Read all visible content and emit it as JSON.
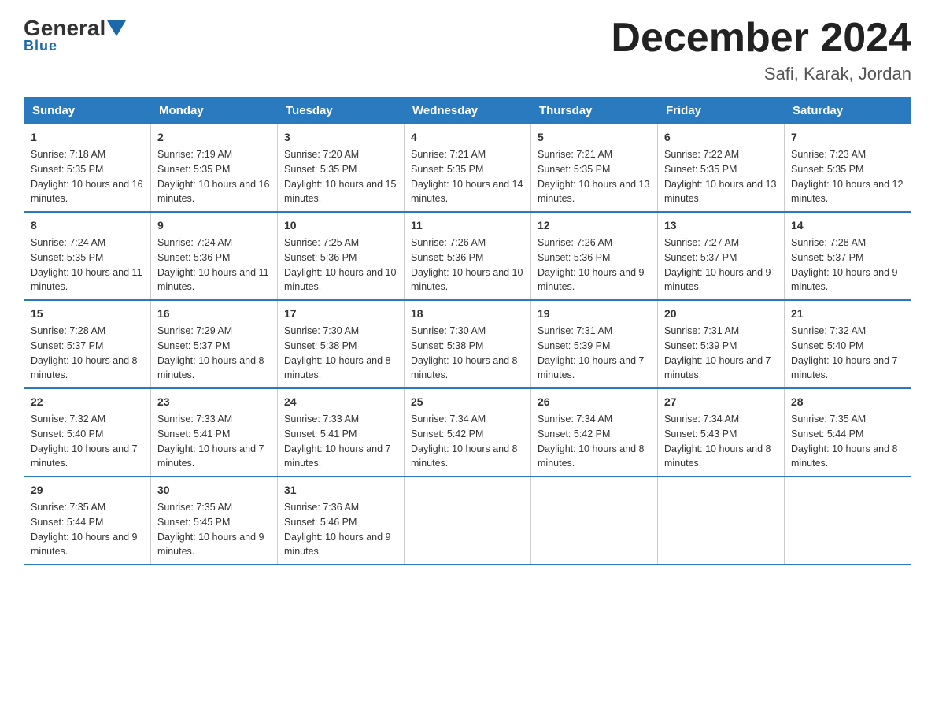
{
  "header": {
    "logo_general": "General",
    "logo_blue": "Blue",
    "month_title": "December 2024",
    "location": "Safi, Karak, Jordan"
  },
  "days_of_week": [
    "Sunday",
    "Monday",
    "Tuesday",
    "Wednesday",
    "Thursday",
    "Friday",
    "Saturday"
  ],
  "weeks": [
    [
      {
        "day": "1",
        "sunrise": "7:18 AM",
        "sunset": "5:35 PM",
        "daylight": "10 hours and 16 minutes."
      },
      {
        "day": "2",
        "sunrise": "7:19 AM",
        "sunset": "5:35 PM",
        "daylight": "10 hours and 16 minutes."
      },
      {
        "day": "3",
        "sunrise": "7:20 AM",
        "sunset": "5:35 PM",
        "daylight": "10 hours and 15 minutes."
      },
      {
        "day": "4",
        "sunrise": "7:21 AM",
        "sunset": "5:35 PM",
        "daylight": "10 hours and 14 minutes."
      },
      {
        "day": "5",
        "sunrise": "7:21 AM",
        "sunset": "5:35 PM",
        "daylight": "10 hours and 13 minutes."
      },
      {
        "day": "6",
        "sunrise": "7:22 AM",
        "sunset": "5:35 PM",
        "daylight": "10 hours and 13 minutes."
      },
      {
        "day": "7",
        "sunrise": "7:23 AM",
        "sunset": "5:35 PM",
        "daylight": "10 hours and 12 minutes."
      }
    ],
    [
      {
        "day": "8",
        "sunrise": "7:24 AM",
        "sunset": "5:35 PM",
        "daylight": "10 hours and 11 minutes."
      },
      {
        "day": "9",
        "sunrise": "7:24 AM",
        "sunset": "5:36 PM",
        "daylight": "10 hours and 11 minutes."
      },
      {
        "day": "10",
        "sunrise": "7:25 AM",
        "sunset": "5:36 PM",
        "daylight": "10 hours and 10 minutes."
      },
      {
        "day": "11",
        "sunrise": "7:26 AM",
        "sunset": "5:36 PM",
        "daylight": "10 hours and 10 minutes."
      },
      {
        "day": "12",
        "sunrise": "7:26 AM",
        "sunset": "5:36 PM",
        "daylight": "10 hours and 9 minutes."
      },
      {
        "day": "13",
        "sunrise": "7:27 AM",
        "sunset": "5:37 PM",
        "daylight": "10 hours and 9 minutes."
      },
      {
        "day": "14",
        "sunrise": "7:28 AM",
        "sunset": "5:37 PM",
        "daylight": "10 hours and 9 minutes."
      }
    ],
    [
      {
        "day": "15",
        "sunrise": "7:28 AM",
        "sunset": "5:37 PM",
        "daylight": "10 hours and 8 minutes."
      },
      {
        "day": "16",
        "sunrise": "7:29 AM",
        "sunset": "5:37 PM",
        "daylight": "10 hours and 8 minutes."
      },
      {
        "day": "17",
        "sunrise": "7:30 AM",
        "sunset": "5:38 PM",
        "daylight": "10 hours and 8 minutes."
      },
      {
        "day": "18",
        "sunrise": "7:30 AM",
        "sunset": "5:38 PM",
        "daylight": "10 hours and 8 minutes."
      },
      {
        "day": "19",
        "sunrise": "7:31 AM",
        "sunset": "5:39 PM",
        "daylight": "10 hours and 7 minutes."
      },
      {
        "day": "20",
        "sunrise": "7:31 AM",
        "sunset": "5:39 PM",
        "daylight": "10 hours and 7 minutes."
      },
      {
        "day": "21",
        "sunrise": "7:32 AM",
        "sunset": "5:40 PM",
        "daylight": "10 hours and 7 minutes."
      }
    ],
    [
      {
        "day": "22",
        "sunrise": "7:32 AM",
        "sunset": "5:40 PM",
        "daylight": "10 hours and 7 minutes."
      },
      {
        "day": "23",
        "sunrise": "7:33 AM",
        "sunset": "5:41 PM",
        "daylight": "10 hours and 7 minutes."
      },
      {
        "day": "24",
        "sunrise": "7:33 AM",
        "sunset": "5:41 PM",
        "daylight": "10 hours and 7 minutes."
      },
      {
        "day": "25",
        "sunrise": "7:34 AM",
        "sunset": "5:42 PM",
        "daylight": "10 hours and 8 minutes."
      },
      {
        "day": "26",
        "sunrise": "7:34 AM",
        "sunset": "5:42 PM",
        "daylight": "10 hours and 8 minutes."
      },
      {
        "day": "27",
        "sunrise": "7:34 AM",
        "sunset": "5:43 PM",
        "daylight": "10 hours and 8 minutes."
      },
      {
        "day": "28",
        "sunrise": "7:35 AM",
        "sunset": "5:44 PM",
        "daylight": "10 hours and 8 minutes."
      }
    ],
    [
      {
        "day": "29",
        "sunrise": "7:35 AM",
        "sunset": "5:44 PM",
        "daylight": "10 hours and 9 minutes."
      },
      {
        "day": "30",
        "sunrise": "7:35 AM",
        "sunset": "5:45 PM",
        "daylight": "10 hours and 9 minutes."
      },
      {
        "day": "31",
        "sunrise": "7:36 AM",
        "sunset": "5:46 PM",
        "daylight": "10 hours and 9 minutes."
      },
      null,
      null,
      null,
      null
    ]
  ],
  "labels": {
    "sunrise": "Sunrise:",
    "sunset": "Sunset:",
    "daylight": "Daylight:"
  }
}
